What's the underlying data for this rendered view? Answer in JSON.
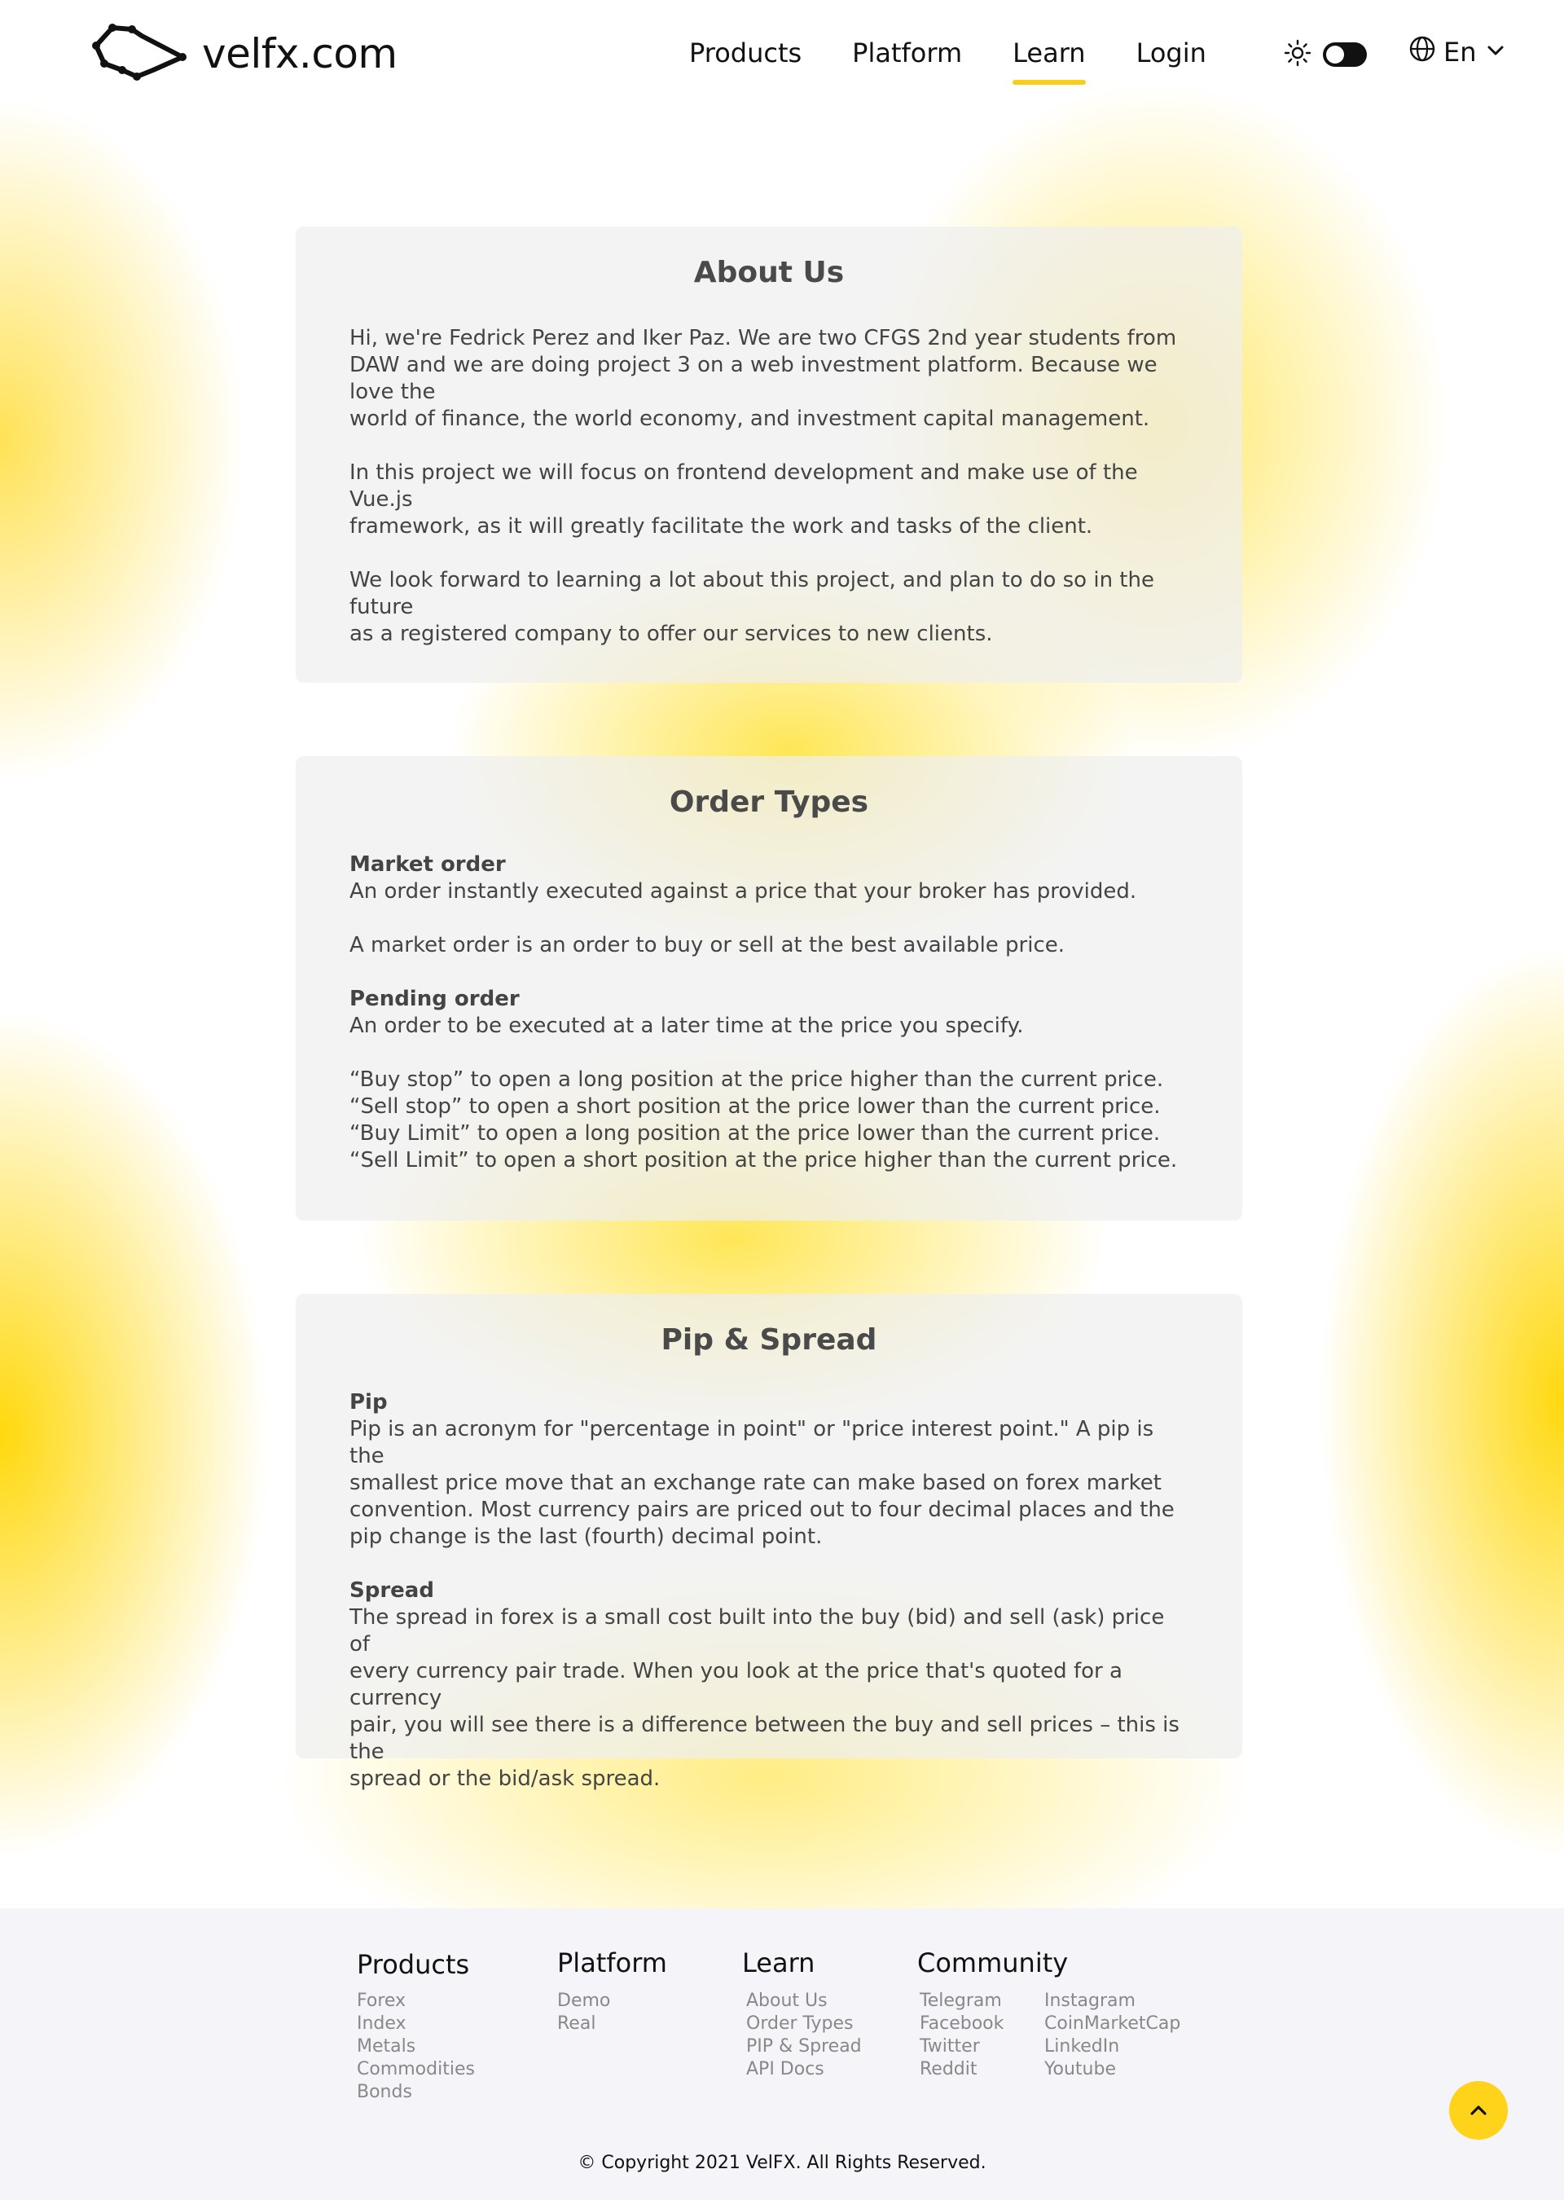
{
  "header": {
    "brand": "velfx.com",
    "nav": [
      "Products",
      "Platform",
      "Learn",
      "Login"
    ],
    "active_nav": "Learn",
    "language": "En",
    "accent": "#f7cf1b"
  },
  "about": {
    "title": "About Us",
    "paragraphs": [
      [
        "Hi, we're Fedrick Perez and Iker Paz. We are two CFGS 2nd year students from",
        "DAW and we are doing project 3 on a web investment platform. Because we love the",
        "world of finance, the world economy, and investment capital management."
      ],
      [
        "In this project we will focus on frontend development and make use of the Vue.js",
        "framework, as it will greatly facilitate the work and tasks of the client."
      ],
      [
        "We look forward to learning a lot about this project, and plan to do so in the future",
        "as a registered company to offer our services to new clients."
      ]
    ]
  },
  "order_types": {
    "title": "Order Types",
    "market_term": "Market order",
    "market_def": "An order instantly executed against a price that your broker has provided.",
    "market_note": "A market order is an order to buy or sell at the best available price.",
    "pending_term": "Pending order",
    "pending_def": "An order to be executed at a later time at the price you specify.",
    "pending_list": [
      "“Buy stop” to open a long position at the price higher than the current price.",
      "“Sell stop” to open a short position at the price lower than the current price.",
      "“Buy Limit” to open a long position at the price lower than the current price.",
      "“Sell Limit” to open a short position at the price higher than the current price."
    ]
  },
  "pip_spread": {
    "title": "Pip & Spread",
    "pip_term": "Pip",
    "pip_lines": [
      "Pip is an acronym for \"percentage in point\" or \"price interest point.\" A pip is the",
      "smallest price move that an exchange rate can make based on forex market",
      "convention. Most currency pairs are priced out to four decimal places and the",
      "pip change is the last (fourth) decimal point."
    ],
    "spread_term": "Spread",
    "spread_lines": [
      "The spread in forex is a small cost built into the buy (bid) and sell (ask) price of",
      "every currency pair trade. When you look at the price that's quoted for a currency",
      "pair, you will see there is a difference between the buy and sell prices – this is the",
      "spread or the bid/ask spread."
    ]
  },
  "footer": {
    "products": {
      "title": "Products",
      "links": [
        "Forex",
        "Index",
        "Metals",
        "Commodities",
        "Bonds"
      ]
    },
    "platform": {
      "title": "Platform",
      "links": [
        "Demo",
        "Real"
      ]
    },
    "learn": {
      "title": "Learn",
      "links": [
        "About  Us",
        "Order Types",
        "PIP & Spread",
        "API Docs"
      ]
    },
    "community": {
      "title": "Community",
      "col1": [
        "Telegram",
        "Facebook",
        "Twitter",
        "Reddit"
      ],
      "col2": [
        "Instagram",
        "CoinMarketCap",
        "LinkedIn",
        "Youtube"
      ]
    },
    "copyright": "© Copyright 2021 VelFX. All Rights Reserved.",
    "back_to_top_icon": "chevron-up-icon"
  }
}
